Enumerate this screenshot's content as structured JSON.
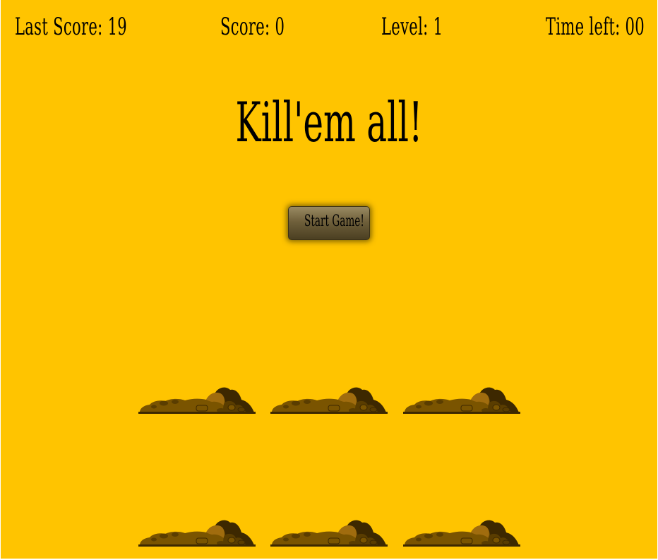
{
  "hud": {
    "last_score": "Last Score: 19",
    "score": "Score: 0",
    "level": "Level: 1",
    "time_left": "Time left: 00"
  },
  "title": "Kill'em all!",
  "start_button": "Start Game!",
  "holes": {
    "rows": 2,
    "columns": 3,
    "icon": "dirt-mound-icon"
  },
  "colors": {
    "background": "#ffc400",
    "dirt_light": "#a06c0e",
    "dirt_mid": "#7a5400",
    "dirt_dark": "#3d2800",
    "button": "#6f603b"
  }
}
